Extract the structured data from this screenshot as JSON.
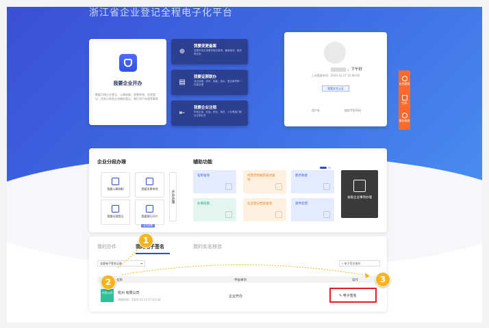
{
  "site_title": "浙江省企业登记全程电子化平台",
  "start_card": {
    "title": "我要企业开办",
    "desc": "数据可线企业登记、公章刻制、发票申领、社保登记、住房公积金企业缴存登记、银行开户办理等事项"
  },
  "ops": [
    {
      "title": "我要变更备案",
      "desc": "变更市场主体基本登记事项、备案事项、委托等业务"
    },
    {
      "title": "我要证照联办",
      "desc": "涉企经营、许可、用能、用水、登记事项等一件事办理"
    },
    {
      "title": "我要企业注销",
      "desc": "市场主体、社保、税务、海关、人社等部门联合注销业务"
    }
  ],
  "user_card": {
    "greeting": "，下午好",
    "last_login": "上次登录时间：2020-12-27 15:40:00",
    "verify_btn": "我要实名认证",
    "link_user_center": "用户名",
    "link_bind_phone": "绑定手机号码"
  },
  "side_tools": [
    {
      "label": "在线客服"
    },
    {
      "label": "扫码"
    },
    {
      "label": "操作指南"
    }
  ],
  "stage_section": {
    "title": "企业分段办理",
    "tiles": [
      {
        "label": "我要公章刻制",
        "icon": "seal-icon"
      },
      {
        "label": "我要发票申领",
        "icon": "invoice-icon"
      },
      {
        "label": "我要社保登记",
        "icon": "social-security-icon"
      },
      {
        "label": "我要银行开户",
        "icon": "bank-icon",
        "badge": "点击查看"
      }
    ],
    "vertical_label": "开办办理"
  },
  "aux_section": {
    "title": "辅助功能",
    "items": [
      {
        "label": "名称查询",
        "bg": "#e4ecff",
        "fg": "#3a5be0"
      },
      {
        "label": "经营范围规范表述查询",
        "bg": "#fff0e0",
        "fg": "#e0822a"
      },
      {
        "label": "税务税收",
        "bg": "#e4ecff",
        "fg": "#3a5be0"
      },
      {
        "label": "办事指南",
        "bg": "#e2f6ee",
        "fg": "#23a77a"
      },
      {
        "label": "企业登记档案查询",
        "bg": "#fff0e0",
        "fg": "#e0822a"
      },
      {
        "label": "退件反馈",
        "bg": "#e4ecff",
        "fg": "#3a5be0"
      }
    ],
    "big_tile": "省级企业事项办理"
  },
  "tabs": [
    "我的办件",
    "我的电子签名",
    "我的实名核验"
  ],
  "filter": {
    "select_value": "全部电子签名记录",
    "search_label": "电子签名操作"
  },
  "table": {
    "headers": [
      "名称",
      "申报事项",
      "操作"
    ],
    "row": {
      "logo_text": "内资公司",
      "name": "杭州          有限公司",
      "date": "申报时间：2020-12-13 17:03:34",
      "source": "企业开办",
      "action": "电子签名"
    }
  },
  "markers": [
    "1",
    "2",
    "3"
  ],
  "colors": {
    "primary": "#2c4ad1",
    "hero": "#3f6fe6",
    "op_card": "#2d3f8f",
    "side_tools": "#ff6a2a",
    "marker": "#f5b51b",
    "highlight": "#e21b2c"
  }
}
